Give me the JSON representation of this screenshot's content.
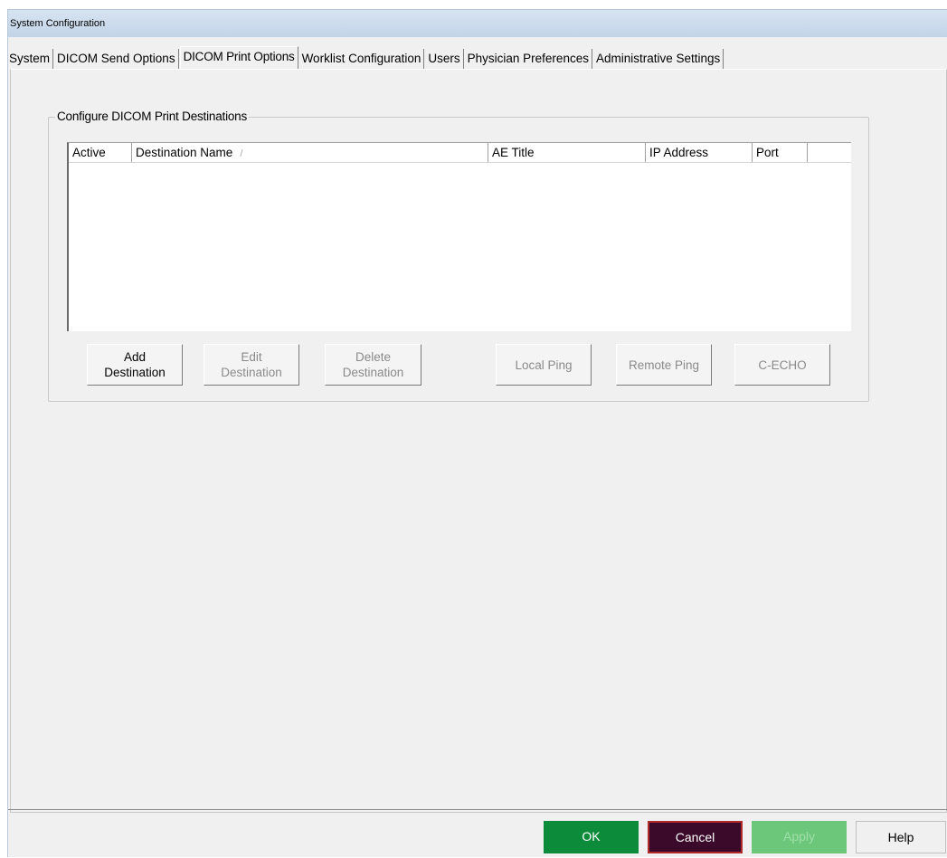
{
  "window": {
    "title": "System Configuration"
  },
  "tabs": [
    {
      "label": "System"
    },
    {
      "label": "DICOM Send Options"
    },
    {
      "label": "DICOM Print Options"
    },
    {
      "label": "Worklist Configuration"
    },
    {
      "label": "Users"
    },
    {
      "label": "Physician Preferences"
    },
    {
      "label": "Administrative Settings"
    }
  ],
  "group": {
    "title": "Configure DICOM Print Destinations",
    "columns": [
      {
        "label": "Active"
      },
      {
        "label": "Destination Name"
      },
      {
        "label": "AE Title"
      },
      {
        "label": "IP Address"
      },
      {
        "label": "Port"
      }
    ],
    "sort_indicator": "/",
    "buttons": {
      "add": [
        "Add",
        "Destination"
      ],
      "edit": [
        "Edit",
        "Destination"
      ],
      "delete": [
        "Delete",
        "Destination"
      ],
      "local_ping": "Local Ping",
      "remote_ping": "Remote Ping",
      "c_echo": "C-ECHO"
    }
  },
  "footer": {
    "ok": "OK",
    "cancel": "Cancel",
    "apply": "Apply",
    "help": "Help"
  },
  "colors": {
    "ok": "#0c8c3a",
    "cancel": "#3b0a2a",
    "cancel_border": "#b22b2b",
    "apply": "#6cc77a"
  }
}
